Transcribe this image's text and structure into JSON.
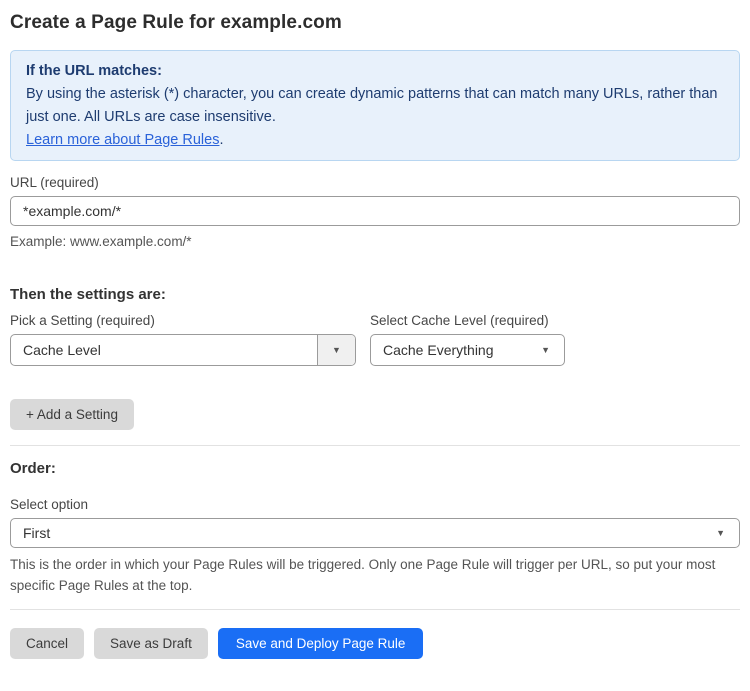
{
  "page": {
    "title": "Create a Page Rule for example.com"
  },
  "info_box": {
    "heading": "If the URL matches:",
    "body": "By using the asterisk (*) character, you can create dynamic patterns that can match many URLs, rather than just one. All URLs are case insensitive.",
    "link_label": "Learn more about Page Rules",
    "link_suffix": ".",
    "bg_color": "#e8f1fb",
    "border_color": "#b8d6f1",
    "text_color": "#1e3c70",
    "link_color": "#2a62d9"
  },
  "url_field": {
    "label": "URL (required)",
    "value": "*example.com/*",
    "helper": "Example: www.example.com/*"
  },
  "settings_section": {
    "heading": "Then the settings are:",
    "setting_picker": {
      "label": "Pick a Setting (required)",
      "value": "Cache Level",
      "dropdown_icon": "▼"
    },
    "cache_level_picker": {
      "label": "Select Cache Level (required)",
      "value": "Cache Everything",
      "dropdown_icon": "▼"
    },
    "add_setting_label": "+ Add a Setting"
  },
  "order_section": {
    "heading": "Order:",
    "label": "Select option",
    "value": "First",
    "dropdown_icon": "▼",
    "helper": "This is the order in which your Page Rules will be triggered. Only one Page Rule will trigger per URL, so put your most specific Page Rules at the top."
  },
  "footer": {
    "cancel_label": "Cancel",
    "save_draft_label": "Save as Draft",
    "save_deploy_label": "Save and Deploy Page Rule",
    "primary_color": "#1a6ef5"
  }
}
